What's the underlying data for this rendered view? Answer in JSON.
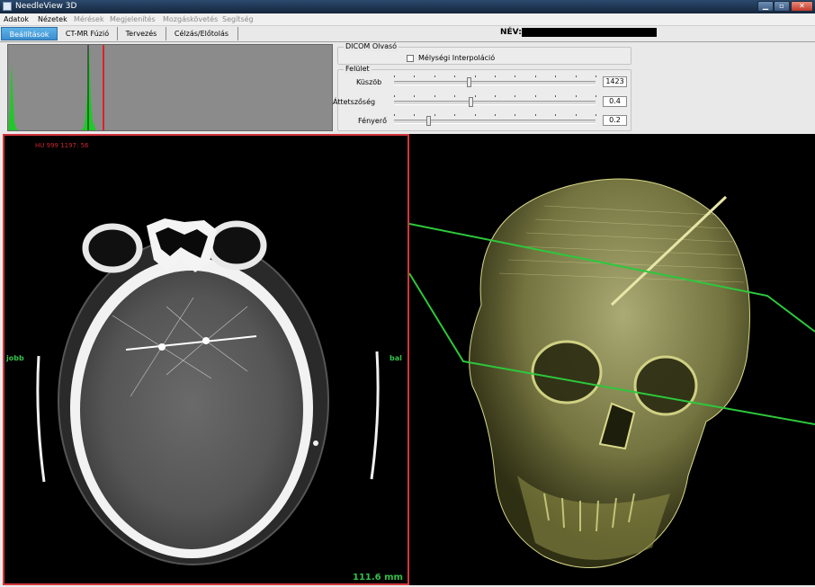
{
  "window": {
    "title": "NeedleView 3D",
    "controls": [
      "minimize",
      "maximize",
      "close"
    ]
  },
  "menu": [
    {
      "label": "Adatok",
      "enabled": true
    },
    {
      "label": "Nézetek",
      "enabled": true
    },
    {
      "label": "Mérések",
      "enabled": false
    },
    {
      "label": "Megjelenítés",
      "enabled": false
    },
    {
      "label": "Mozgáskövetés",
      "enabled": false
    },
    {
      "label": "Segítség",
      "enabled": false
    }
  ],
  "tabs": [
    {
      "label": "Beállítások",
      "active": true
    },
    {
      "label": "CT-MR Fúzió",
      "active": false
    },
    {
      "label": "Tervezés",
      "active": false
    },
    {
      "label": "Célzás/Előtolás",
      "active": false
    }
  ],
  "patient": {
    "name_label": "NÉV:",
    "name_value": ""
  },
  "dicom_group": {
    "title": "DICOM Olvasó",
    "checkbox_label": "Mélységi Interpoláció",
    "checked": false
  },
  "surface_group": {
    "title": "Felület",
    "sliders": [
      {
        "label": "Küszöb",
        "value": "1423",
        "position_fraction": 0.37
      },
      {
        "label": "Áttetszőség",
        "value": "0.4",
        "position_fraction": 0.38
      },
      {
        "label": "Fényerő",
        "value": "0.2",
        "position_fraction": 0.17
      }
    ]
  },
  "ct_view": {
    "hu_text": "HU 999 1197: 56",
    "label_right_side": "jobb",
    "label_left_side": "bal",
    "scale_text": "111.6 mm",
    "border_color": "#d2353d"
  },
  "colors": {
    "accent_tab": "#3a8fd0",
    "histogram_green": "#22c72a",
    "histogram_marker": "#e0202a",
    "overlay_green": "#33c04a",
    "render_yellow": "#d9d98a",
    "plane_green": "#2dc83c"
  }
}
